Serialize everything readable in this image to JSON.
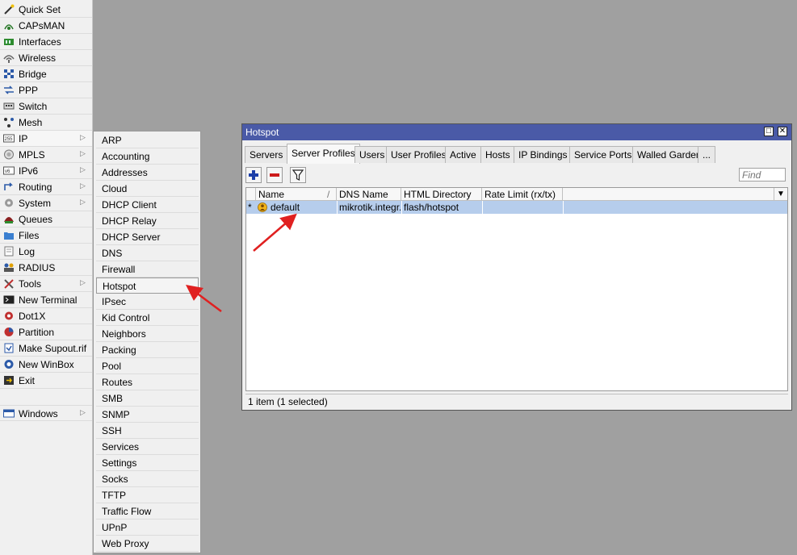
{
  "main_menu": {
    "items": [
      {
        "label": "Quick Set",
        "icon": "wand-icon",
        "submenu": false
      },
      {
        "label": "CAPsMAN",
        "icon": "capsman-icon",
        "submenu": false
      },
      {
        "label": "Interfaces",
        "icon": "interfaces-icon",
        "submenu": false
      },
      {
        "label": "Wireless",
        "icon": "wireless-icon",
        "submenu": false
      },
      {
        "label": "Bridge",
        "icon": "bridge-icon",
        "submenu": false
      },
      {
        "label": "PPP",
        "icon": "ppp-icon",
        "submenu": false
      },
      {
        "label": "Switch",
        "icon": "switch-icon",
        "submenu": false
      },
      {
        "label": "Mesh",
        "icon": "mesh-icon",
        "submenu": false
      },
      {
        "label": "IP",
        "icon": "ip-icon",
        "submenu": true
      },
      {
        "label": "MPLS",
        "icon": "mpls-icon",
        "submenu": true
      },
      {
        "label": "IPv6",
        "icon": "ipv6-icon",
        "submenu": true
      },
      {
        "label": "Routing",
        "icon": "routing-icon",
        "submenu": true
      },
      {
        "label": "System",
        "icon": "gear-icon",
        "submenu": true
      },
      {
        "label": "Queues",
        "icon": "queues-icon",
        "submenu": false
      },
      {
        "label": "Files",
        "icon": "folder-icon",
        "submenu": false
      },
      {
        "label": "Log",
        "icon": "log-icon",
        "submenu": false
      },
      {
        "label": "RADIUS",
        "icon": "radius-icon",
        "submenu": false
      },
      {
        "label": "Tools",
        "icon": "tools-icon",
        "submenu": true
      },
      {
        "label": "New Terminal",
        "icon": "terminal-icon",
        "submenu": false
      },
      {
        "label": "Dot1X",
        "icon": "dot1x-icon",
        "submenu": false
      },
      {
        "label": "Partition",
        "icon": "partition-icon",
        "submenu": false
      },
      {
        "label": "Make Supout.rif",
        "icon": "supout-icon",
        "submenu": false
      },
      {
        "label": "New WinBox",
        "icon": "winbox-icon",
        "submenu": false
      },
      {
        "label": "Exit",
        "icon": "exit-icon",
        "submenu": false
      }
    ],
    "windows": {
      "label": "Windows",
      "icon": "windows-icon"
    },
    "submenu_arrow": "▷"
  },
  "ip_submenu": {
    "items": [
      "ARP",
      "Accounting",
      "Addresses",
      "Cloud",
      "DHCP Client",
      "DHCP Relay",
      "DHCP Server",
      "DNS",
      "Firewall",
      "Hotspot",
      "IPsec",
      "Kid Control",
      "Neighbors",
      "Packing",
      "Pool",
      "Routes",
      "SMB",
      "SNMP",
      "SSH",
      "Services",
      "Settings",
      "Socks",
      "TFTP",
      "Traffic Flow",
      "UPnP",
      "Web Proxy"
    ],
    "highlighted": "Hotspot"
  },
  "window": {
    "title": "Hotspot",
    "maximize_glyph": "□",
    "close_glyph": "✕",
    "tabs": [
      "Servers",
      "Server Profiles",
      "Users",
      "User Profiles",
      "Active",
      "Hosts",
      "IP Bindings",
      "Service Ports",
      "Walled Garden",
      "..."
    ],
    "selected_tab": "Server Profiles",
    "find_placeholder": "Find",
    "columns": [
      "Name",
      "DNS Name",
      "HTML Directory",
      "Rate Limit (rx/tx)"
    ],
    "sort_glyph": "/",
    "dropdown_glyph": "▼",
    "rows": [
      {
        "marker": "*",
        "name": "default",
        "dns_name": "mikrotik.integr...",
        "html_directory": "flash/hotspot",
        "rate_limit": ""
      }
    ],
    "status": "1 item (1 selected)"
  },
  "colors": {
    "title_bar": "#4a5aa7",
    "selected_row": "#b6cdec",
    "annotation_arrow": "#e02020",
    "add_icon": "#1d3fa8",
    "remove_icon": "#cc1b1b"
  }
}
